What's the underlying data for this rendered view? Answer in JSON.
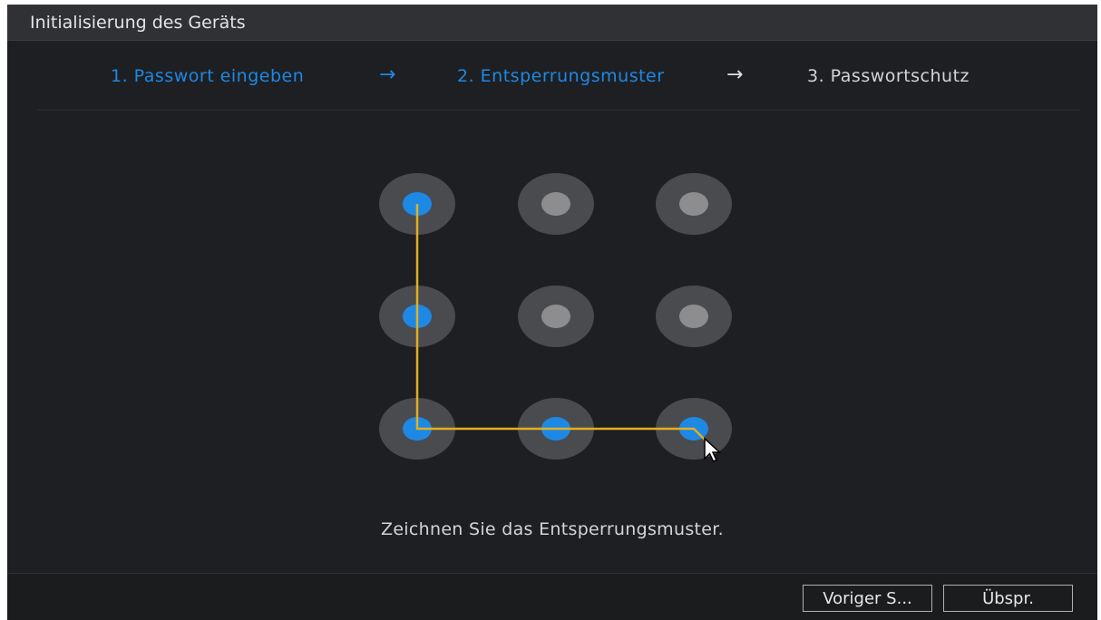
{
  "window": {
    "title": "Initialisierung des Geräts"
  },
  "steps": [
    {
      "label": "1.  Passwort eingeben",
      "state": "done"
    },
    {
      "label": "2.  Entsperrungsmuster",
      "state": "current"
    },
    {
      "label": "3.  Passwortschutz",
      "state": "pending"
    }
  ],
  "step_arrow_symbol": "→",
  "pattern": {
    "grid": [
      [
        true,
        false,
        false
      ],
      [
        true,
        false,
        false
      ],
      [
        true,
        true,
        true
      ]
    ],
    "path": [
      [
        0,
        0
      ],
      [
        1,
        0
      ],
      [
        2,
        0
      ],
      [
        2,
        1
      ],
      [
        2,
        2
      ]
    ],
    "line_color": "#e0b020",
    "active_dot_color": "#1e88e5",
    "inactive_dot_color": "#8d8d90"
  },
  "hint": "Zeichnen Sie das Entsperrungsmuster.",
  "buttons": {
    "previous": "Voriger S...",
    "skip": "Übspr."
  },
  "icons": {
    "cursor": "arrow-pointer-icon"
  }
}
